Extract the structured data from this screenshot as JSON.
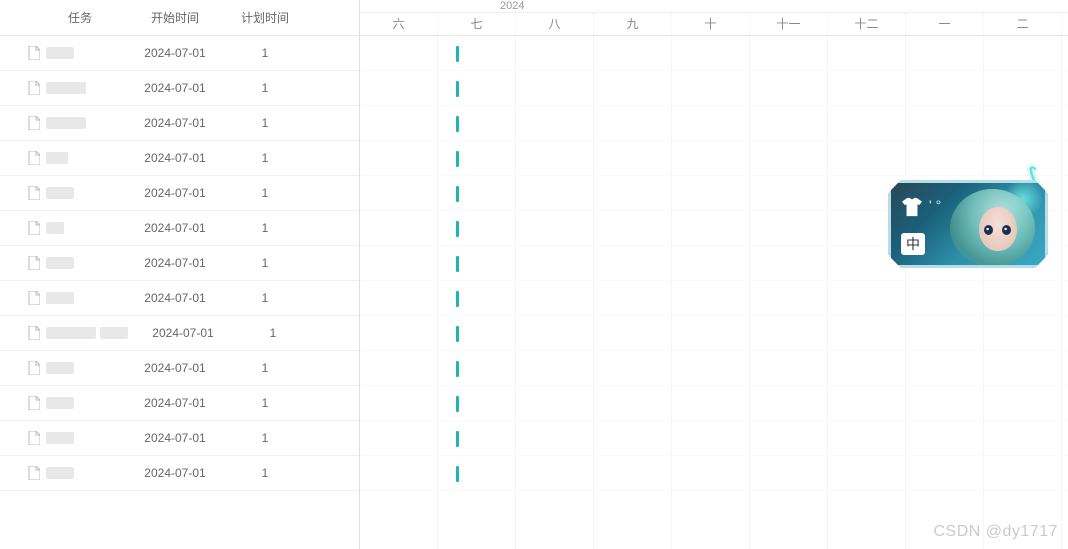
{
  "headers": {
    "task": "任务",
    "start": "开始时间",
    "plan": "计划时间"
  },
  "timeline": {
    "year": "2024",
    "months": [
      "六",
      "七",
      "八",
      "九",
      "十",
      "十一",
      "十二",
      "一",
      "二"
    ]
  },
  "tasks": [
    {
      "start": "2024-07-01",
      "plan": "1",
      "nameWidth": "w1"
    },
    {
      "start": "2024-07-01",
      "plan": "1",
      "nameWidth": "w2"
    },
    {
      "start": "2024-07-01",
      "plan": "1",
      "nameWidth": "w2"
    },
    {
      "start": "2024-07-01",
      "plan": "1",
      "nameWidth": "w3"
    },
    {
      "start": "2024-07-01",
      "plan": "1",
      "nameWidth": "w1"
    },
    {
      "start": "2024-07-01",
      "plan": "1",
      "nameWidth": "w5"
    },
    {
      "start": "2024-07-01",
      "plan": "1",
      "nameWidth": "w1"
    },
    {
      "start": "2024-07-01",
      "plan": "1",
      "nameWidth": "w1"
    },
    {
      "start": "2024-07-01",
      "plan": "1",
      "nameWidth": "w4",
      "extra": true
    },
    {
      "start": "2024-07-01",
      "plan": "1",
      "nameWidth": "w1"
    },
    {
      "start": "2024-07-01",
      "plan": "1",
      "nameWidth": "w1"
    },
    {
      "start": "2024-07-01",
      "plan": "1",
      "nameWidth": "w1"
    },
    {
      "start": "2024-07-01",
      "plan": "1",
      "nameWidth": "w1"
    }
  ],
  "widget": {
    "label": "中"
  },
  "watermark": "CSDN @dy1717"
}
